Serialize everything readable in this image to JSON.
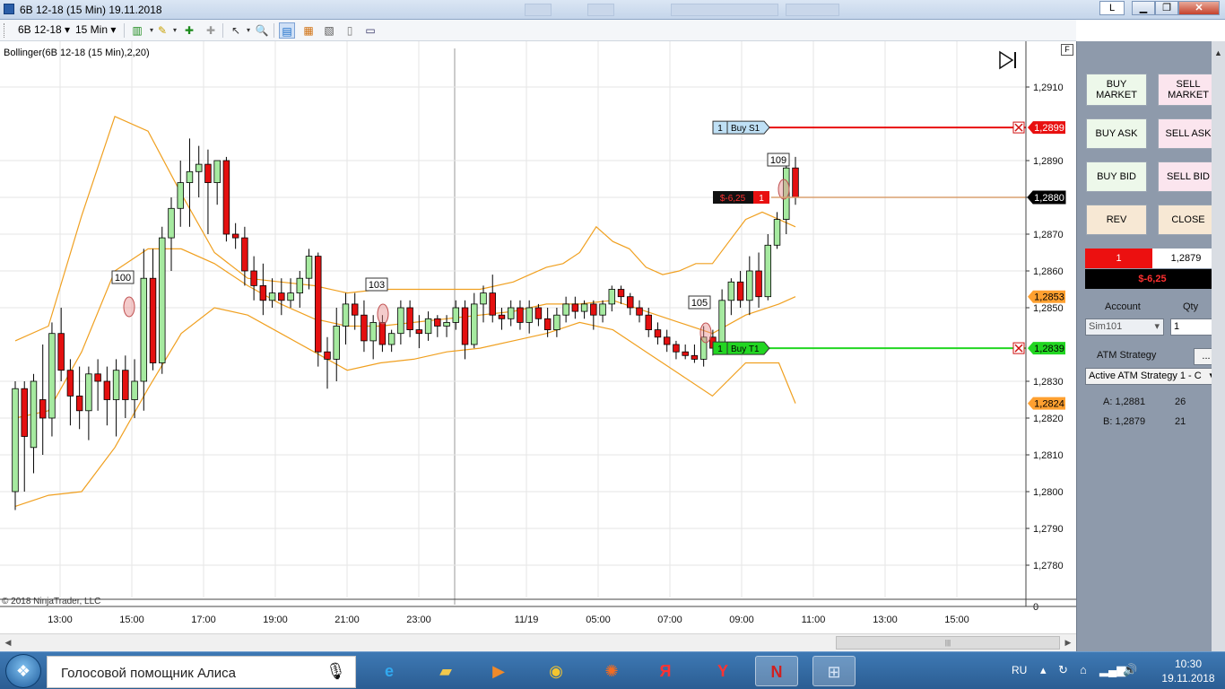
{
  "window": {
    "title": "6B 12-18 (15 Min)  19.11.2018",
    "link_button": "L",
    "minimize": "▁",
    "maximize": "❐",
    "close": "✕"
  },
  "toolbar": {
    "instrument": "6B 12-18",
    "interval": "15 Min"
  },
  "chart": {
    "indicator_label": "Bollinger(6B 12-18 (15 Min),2,20)",
    "copyright": "© 2018 NinjaTrader, LLC",
    "f_label": "F",
    "x_ticks": [
      "13:00",
      "15:00",
      "17:00",
      "19:00",
      "21:00",
      "23:00",
      "11/19",
      "05:00",
      "07:00",
      "09:00",
      "11:00",
      "13:00",
      "15:00"
    ],
    "y_ticks": [
      "1,2910",
      "1,2890",
      "1,2880",
      "1,2870",
      "1,2860",
      "1,2850",
      "1,2830",
      "1,2820",
      "1,2810",
      "1,2800",
      "1,2790",
      "1,2780",
      "0"
    ],
    "price_markers": [
      {
        "label": "1,2899",
        "kind": "stop",
        "color": "#e81010"
      },
      {
        "label": "1,2880",
        "kind": "last",
        "color": "#000000"
      },
      {
        "label": "1,2853",
        "kind": "band",
        "color": "#ffa030"
      },
      {
        "label": "1,2839",
        "kind": "target",
        "color": "#22d622"
      },
      {
        "label": "1,2824",
        "kind": "band",
        "color": "#ffa030"
      }
    ],
    "orders": [
      {
        "qty": "1",
        "name": "Buy S1",
        "color": "#e81010"
      },
      {
        "qty": "1",
        "name": "Buy T1",
        "color": "#22d622"
      }
    ],
    "position": {
      "pnl": "$-6,25",
      "qty": "1"
    },
    "bar_labels": [
      "100",
      "103",
      "105",
      "109"
    ],
    "colors": {
      "up": "#a6eaa0",
      "down": "#e41010",
      "band": "#f0a020",
      "grid": "#e6e6e6"
    }
  },
  "chart_data": {
    "type": "candlestick",
    "title": "6B 12-18 (15 Min)",
    "indicator": "Bollinger(6B 12-18 (15 Min),2,20)",
    "x": [
      "13:00",
      "15:00",
      "17:00",
      "19:00",
      "21:00",
      "23:00",
      "11/19",
      "05:00",
      "07:00",
      "09:00",
      "11:00",
      "13:00",
      "15:00"
    ],
    "ylim": [
      1.2775,
      1.2918
    ],
    "last_price": 1.288,
    "stop_price": 1.2899,
    "target_price": 1.2839,
    "upper_band_last": 1.2853,
    "lower_band_last": 1.2824,
    "candles": [
      [
        1.28,
        1.283,
        1.2795,
        1.2828
      ],
      [
        1.2828,
        1.283,
        1.28,
        1.2815
      ],
      [
        1.2812,
        1.2832,
        1.2805,
        1.283
      ],
      [
        1.2825,
        1.284,
        1.281,
        1.282
      ],
      [
        1.282,
        1.2846,
        1.2815,
        1.2843
      ],
      [
        1.2843,
        1.285,
        1.283,
        1.2833
      ],
      [
        1.2833,
        1.2836,
        1.2818,
        1.2826
      ],
      [
        1.2826,
        1.2834,
        1.2817,
        1.2822
      ],
      [
        1.2822,
        1.2834,
        1.2814,
        1.2832
      ],
      [
        1.2832,
        1.2836,
        1.2822,
        1.283
      ],
      [
        1.283,
        1.2834,
        1.2818,
        1.2825
      ],
      [
        1.2825,
        1.2836,
        1.2815,
        1.2833
      ],
      [
        1.2833,
        1.2837,
        1.282,
        1.2825
      ],
      [
        1.2825,
        1.2836,
        1.282,
        1.283
      ],
      [
        1.283,
        1.2866,
        1.2822,
        1.2858
      ],
      [
        1.2858,
        1.2866,
        1.2833,
        1.2835
      ],
      [
        1.2835,
        1.2872,
        1.2832,
        1.2869
      ],
      [
        1.2869,
        1.288,
        1.286,
        1.2877
      ],
      [
        1.2877,
        1.289,
        1.2872,
        1.2884
      ],
      [
        1.2884,
        1.2896,
        1.2872,
        1.2887
      ],
      [
        1.2887,
        1.2894,
        1.288,
        1.2889
      ],
      [
        1.2889,
        1.2893,
        1.287,
        1.2884
      ],
      [
        1.2884,
        1.289,
        1.2878,
        1.289
      ],
      [
        1.289,
        1.2891,
        1.2868,
        1.287
      ],
      [
        1.287,
        1.2873,
        1.2866,
        1.2869
      ],
      [
        1.2869,
        1.2872,
        1.2856,
        1.286
      ],
      [
        1.286,
        1.2864,
        1.2852,
        1.2856
      ],
      [
        1.2856,
        1.2862,
        1.2848,
        1.2852
      ],
      [
        1.2852,
        1.2858,
        1.285,
        1.2854
      ],
      [
        1.2854,
        1.2858,
        1.2848,
        1.2852
      ],
      [
        1.2852,
        1.2858,
        1.285,
        1.2854
      ],
      [
        1.2854,
        1.286,
        1.285,
        1.2858
      ],
      [
        1.2858,
        1.2866,
        1.2855,
        1.2864
      ],
      [
        1.2864,
        1.2865,
        1.2834,
        1.2838
      ],
      [
        1.2838,
        1.2842,
        1.2828,
        1.2836
      ],
      [
        1.2836,
        1.285,
        1.283,
        1.2845
      ],
      [
        1.2845,
        1.2854,
        1.284,
        1.2851
      ],
      [
        1.2851,
        1.2854,
        1.2844,
        1.2848
      ],
      [
        1.2848,
        1.2852,
        1.2838,
        1.2841
      ],
      [
        1.2841,
        1.2848,
        1.2836,
        1.2846
      ],
      [
        1.2846,
        1.2848,
        1.2838,
        1.284
      ],
      [
        1.284,
        1.2844,
        1.2838,
        1.2843
      ],
      [
        1.2843,
        1.2852,
        1.284,
        1.285
      ],
      [
        1.285,
        1.2852,
        1.2842,
        1.2844
      ],
      [
        1.2844,
        1.2848,
        1.2839,
        1.2843
      ],
      [
        1.2843,
        1.2849,
        1.2841,
        1.2847
      ],
      [
        1.2847,
        1.2848,
        1.2842,
        1.2845
      ],
      [
        1.2845,
        1.2848,
        1.2842,
        1.2846
      ],
      [
        1.2846,
        1.2852,
        1.2844,
        1.285
      ],
      [
        1.285,
        1.2852,
        1.2836,
        1.284
      ],
      [
        1.284,
        1.2854,
        1.2839,
        1.2851
      ],
      [
        1.2851,
        1.2856,
        1.2846,
        1.2854
      ],
      [
        1.2854,
        1.2859,
        1.2846,
        1.2848
      ],
      [
        1.2848,
        1.285,
        1.2844,
        1.2847
      ],
      [
        1.2847,
        1.2852,
        1.2845,
        1.285
      ],
      [
        1.285,
        1.2852,
        1.2844,
        1.2846
      ],
      [
        1.2846,
        1.2852,
        1.2843,
        1.285
      ],
      [
        1.285,
        1.2851,
        1.2845,
        1.2847
      ],
      [
        1.2847,
        1.285,
        1.2842,
        1.2844
      ],
      [
        1.2844,
        1.285,
        1.2842,
        1.2848
      ],
      [
        1.2848,
        1.2853,
        1.2846,
        1.2851
      ],
      [
        1.2851,
        1.2853,
        1.2847,
        1.2849
      ],
      [
        1.2849,
        1.2852,
        1.2847,
        1.2851
      ],
      [
        1.2851,
        1.2852,
        1.2844,
        1.2848
      ],
      [
        1.2848,
        1.2852,
        1.2846,
        1.2851
      ],
      [
        1.2851,
        1.2856,
        1.2849,
        1.2855
      ],
      [
        1.2855,
        1.2856,
        1.2851,
        1.2853
      ],
      [
        1.2853,
        1.2854,
        1.2848,
        1.285
      ],
      [
        1.285,
        1.2852,
        1.2846,
        1.2848
      ],
      [
        1.2848,
        1.285,
        1.2842,
        1.2844
      ],
      [
        1.2844,
        1.2846,
        1.284,
        1.2842
      ],
      [
        1.2842,
        1.2844,
        1.2838,
        1.284
      ],
      [
        1.284,
        1.2841,
        1.2836,
        1.2838
      ],
      [
        1.2838,
        1.284,
        1.2836,
        1.2837
      ],
      [
        1.2837,
        1.284,
        1.2835,
        1.2836
      ],
      [
        1.2836,
        1.2845,
        1.2834,
        1.2842
      ],
      [
        1.2842,
        1.2844,
        1.2837,
        1.2839
      ],
      [
        1.2839,
        1.2855,
        1.2838,
        1.2852
      ],
      [
        1.2852,
        1.2858,
        1.2848,
        1.2857
      ],
      [
        1.2857,
        1.286,
        1.285,
        1.2852
      ],
      [
        1.2852,
        1.2864,
        1.2848,
        1.286
      ],
      [
        1.286,
        1.2865,
        1.285,
        1.2853
      ],
      [
        1.2853,
        1.287,
        1.2852,
        1.2867
      ],
      [
        1.2867,
        1.2876,
        1.2866,
        1.2874
      ],
      [
        1.2874,
        1.289,
        1.287,
        1.2888
      ],
      [
        1.2888,
        1.2891,
        1.2878,
        1.288
      ]
    ],
    "bollinger": {
      "upper": [
        [
          0,
          1.2841
        ],
        [
          10,
          1.2845
        ],
        [
          20,
          1.2875
        ],
        [
          30,
          1.2902
        ],
        [
          40,
          1.2898
        ],
        [
          50,
          1.2881
        ],
        [
          60,
          1.2865
        ],
        [
          70,
          1.2858
        ],
        [
          80,
          1.2857
        ],
        [
          90,
          1.2856
        ],
        [
          100,
          1.2854
        ],
        [
          110,
          1.2855
        ],
        [
          120,
          1.2855
        ],
        [
          130,
          1.2855
        ],
        [
          140,
          1.2855
        ],
        [
          150,
          1.2857
        ],
        [
          155,
          1.2859
        ],
        [
          160,
          1.2861
        ],
        [
          165,
          1.2862
        ],
        [
          170,
          1.2865
        ],
        [
          175,
          1.2872
        ],
        [
          180,
          1.2868
        ],
        [
          185,
          1.2866
        ],
        [
          190,
          1.2861
        ],
        [
          195,
          1.2859
        ],
        [
          200,
          1.286
        ],
        [
          205,
          1.2862
        ],
        [
          210,
          1.2862
        ],
        [
          215,
          1.2868
        ],
        [
          220,
          1.2874
        ],
        [
          225,
          1.2876
        ],
        [
          230,
          1.2874
        ],
        [
          235,
          1.2872
        ]
      ],
      "middle": [
        [
          0,
          1.282
        ],
        [
          10,
          1.2822
        ],
        [
          20,
          1.2838
        ],
        [
          30,
          1.286
        ],
        [
          40,
          1.2866
        ],
        [
          50,
          1.2866
        ],
        [
          60,
          1.2862
        ],
        [
          70,
          1.2856
        ],
        [
          80,
          1.2851
        ],
        [
          90,
          1.2847
        ],
        [
          100,
          1.2845
        ],
        [
          110,
          1.2845
        ],
        [
          120,
          1.2846
        ],
        [
          130,
          1.2847
        ],
        [
          140,
          1.2848
        ],
        [
          150,
          1.2849
        ],
        [
          160,
          1.2851
        ],
        [
          170,
          1.2851
        ],
        [
          180,
          1.2852
        ],
        [
          190,
          1.2849
        ],
        [
          200,
          1.2846
        ],
        [
          210,
          1.2843
        ],
        [
          220,
          1.2848
        ],
        [
          230,
          1.2851
        ],
        [
          235,
          1.2853
        ]
      ],
      "lower": [
        [
          0,
          1.2796
        ],
        [
          10,
          1.2799
        ],
        [
          20,
          1.28
        ],
        [
          30,
          1.2812
        ],
        [
          40,
          1.2828
        ],
        [
          50,
          1.2843
        ],
        [
          60,
          1.285
        ],
        [
          70,
          1.2848
        ],
        [
          80,
          1.2843
        ],
        [
          90,
          1.2838
        ],
        [
          100,
          1.2833
        ],
        [
          110,
          1.2835
        ],
        [
          120,
          1.2836
        ],
        [
          130,
          1.2838
        ],
        [
          140,
          1.2839
        ],
        [
          150,
          1.2841
        ],
        [
          160,
          1.2843
        ],
        [
          170,
          1.2846
        ],
        [
          180,
          1.2844
        ],
        [
          190,
          1.2838
        ],
        [
          200,
          1.2832
        ],
        [
          210,
          1.2826
        ],
        [
          220,
          1.2835
        ],
        [
          230,
          1.2835
        ],
        [
          235,
          1.2824
        ]
      ]
    }
  },
  "order_panel": {
    "buy_market": "BUY MARKET",
    "sell_market": "SELL MARKET",
    "buy_ask": "BUY ASK",
    "sell_ask": "SELL ASK",
    "buy_bid": "BUY BID",
    "sell_bid": "SELL BID",
    "rev": "REV",
    "close": "CLOSE",
    "position_qty": "1",
    "position_price": "1,2879",
    "position_pnl": "$-6,25",
    "account_label": "Account",
    "qty_label": "Qty",
    "account_value": "Sim101",
    "qty_value": "1",
    "atm_label": "ATM Strategy",
    "atm_button": "...",
    "atm_value": "Active ATM Strategy 1 - C",
    "ask_label": "A: 1,2881",
    "ask_size": "26",
    "bid_label": "B: 1,2879",
    "bid_size": "21"
  },
  "taskbar": {
    "assistant_text": "Голосовой помощник Алиса",
    "language": "RU",
    "time": "10:30",
    "date": "19.11.2018",
    "apps": [
      "ie-icon",
      "explorer-icon",
      "media-player-icon",
      "chrome-icon",
      "circle-app-icon",
      "yandex-icon",
      "yandex-browser-icon",
      "ninjatrader-icon",
      "control-panel-icon"
    ]
  }
}
